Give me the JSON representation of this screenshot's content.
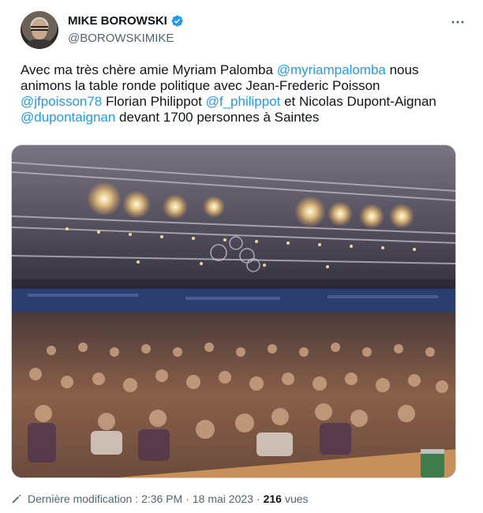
{
  "author": {
    "name": "MIKE BOROWSKI",
    "handle": "@BOROWSKIMIKE",
    "verified": true,
    "avatar_icon": "avatar-photo"
  },
  "menu": {
    "more_icon": "⋯"
  },
  "tweet": {
    "segments": [
      {
        "text": "Avec ma très chère amie Myriam Palomba ",
        "type": "text"
      },
      {
        "text": "@myriampalomba",
        "type": "mention"
      },
      {
        "text": " nous animons la table ronde politique avec Jean-Frederic Poisson ",
        "type": "text"
      },
      {
        "text": "@jfpoisson78",
        "type": "mention"
      },
      {
        "text": " Florian Philippot ",
        "type": "text"
      },
      {
        "text": "@f_philippot",
        "type": "mention"
      },
      {
        "text": " et Nicolas Dupont-Aignan ",
        "type": "text"
      },
      {
        "text": "@dupontaignan",
        "type": "mention"
      },
      {
        "text": " devant 1700 personnes à Saintes",
        "type": "text"
      }
    ]
  },
  "media": {
    "icon": "crowd-photo"
  },
  "meta": {
    "edited_label": "Dernière modification :",
    "time": "2:36 PM",
    "separator": "·",
    "date": "18 mai 2023",
    "views_count": "216",
    "views_label": "vues"
  },
  "colors": {
    "mention": "#1d9bf0",
    "secondary_text": "#536471",
    "verified": "#1d9bf0"
  }
}
